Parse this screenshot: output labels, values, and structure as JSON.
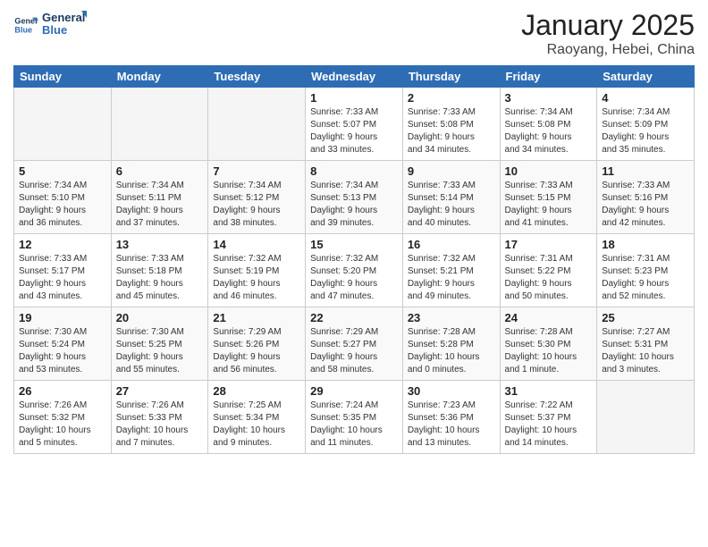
{
  "header": {
    "logo_line1": "General",
    "logo_line2": "Blue",
    "title": "January 2025",
    "subtitle": "Raoyang, Hebei, China"
  },
  "weekdays": [
    "Sunday",
    "Monday",
    "Tuesday",
    "Wednesday",
    "Thursday",
    "Friday",
    "Saturday"
  ],
  "weeks": [
    [
      {
        "day": "",
        "info": ""
      },
      {
        "day": "",
        "info": ""
      },
      {
        "day": "",
        "info": ""
      },
      {
        "day": "1",
        "info": "Sunrise: 7:33 AM\nSunset: 5:07 PM\nDaylight: 9 hours\nand 33 minutes."
      },
      {
        "day": "2",
        "info": "Sunrise: 7:33 AM\nSunset: 5:08 PM\nDaylight: 9 hours\nand 34 minutes."
      },
      {
        "day": "3",
        "info": "Sunrise: 7:34 AM\nSunset: 5:08 PM\nDaylight: 9 hours\nand 34 minutes."
      },
      {
        "day": "4",
        "info": "Sunrise: 7:34 AM\nSunset: 5:09 PM\nDaylight: 9 hours\nand 35 minutes."
      }
    ],
    [
      {
        "day": "5",
        "info": "Sunrise: 7:34 AM\nSunset: 5:10 PM\nDaylight: 9 hours\nand 36 minutes."
      },
      {
        "day": "6",
        "info": "Sunrise: 7:34 AM\nSunset: 5:11 PM\nDaylight: 9 hours\nand 37 minutes."
      },
      {
        "day": "7",
        "info": "Sunrise: 7:34 AM\nSunset: 5:12 PM\nDaylight: 9 hours\nand 38 minutes."
      },
      {
        "day": "8",
        "info": "Sunrise: 7:34 AM\nSunset: 5:13 PM\nDaylight: 9 hours\nand 39 minutes."
      },
      {
        "day": "9",
        "info": "Sunrise: 7:33 AM\nSunset: 5:14 PM\nDaylight: 9 hours\nand 40 minutes."
      },
      {
        "day": "10",
        "info": "Sunrise: 7:33 AM\nSunset: 5:15 PM\nDaylight: 9 hours\nand 41 minutes."
      },
      {
        "day": "11",
        "info": "Sunrise: 7:33 AM\nSunset: 5:16 PM\nDaylight: 9 hours\nand 42 minutes."
      }
    ],
    [
      {
        "day": "12",
        "info": "Sunrise: 7:33 AM\nSunset: 5:17 PM\nDaylight: 9 hours\nand 43 minutes."
      },
      {
        "day": "13",
        "info": "Sunrise: 7:33 AM\nSunset: 5:18 PM\nDaylight: 9 hours\nand 45 minutes."
      },
      {
        "day": "14",
        "info": "Sunrise: 7:32 AM\nSunset: 5:19 PM\nDaylight: 9 hours\nand 46 minutes."
      },
      {
        "day": "15",
        "info": "Sunrise: 7:32 AM\nSunset: 5:20 PM\nDaylight: 9 hours\nand 47 minutes."
      },
      {
        "day": "16",
        "info": "Sunrise: 7:32 AM\nSunset: 5:21 PM\nDaylight: 9 hours\nand 49 minutes."
      },
      {
        "day": "17",
        "info": "Sunrise: 7:31 AM\nSunset: 5:22 PM\nDaylight: 9 hours\nand 50 minutes."
      },
      {
        "day": "18",
        "info": "Sunrise: 7:31 AM\nSunset: 5:23 PM\nDaylight: 9 hours\nand 52 minutes."
      }
    ],
    [
      {
        "day": "19",
        "info": "Sunrise: 7:30 AM\nSunset: 5:24 PM\nDaylight: 9 hours\nand 53 minutes."
      },
      {
        "day": "20",
        "info": "Sunrise: 7:30 AM\nSunset: 5:25 PM\nDaylight: 9 hours\nand 55 minutes."
      },
      {
        "day": "21",
        "info": "Sunrise: 7:29 AM\nSunset: 5:26 PM\nDaylight: 9 hours\nand 56 minutes."
      },
      {
        "day": "22",
        "info": "Sunrise: 7:29 AM\nSunset: 5:27 PM\nDaylight: 9 hours\nand 58 minutes."
      },
      {
        "day": "23",
        "info": "Sunrise: 7:28 AM\nSunset: 5:28 PM\nDaylight: 10 hours\nand 0 minutes."
      },
      {
        "day": "24",
        "info": "Sunrise: 7:28 AM\nSunset: 5:30 PM\nDaylight: 10 hours\nand 1 minute."
      },
      {
        "day": "25",
        "info": "Sunrise: 7:27 AM\nSunset: 5:31 PM\nDaylight: 10 hours\nand 3 minutes."
      }
    ],
    [
      {
        "day": "26",
        "info": "Sunrise: 7:26 AM\nSunset: 5:32 PM\nDaylight: 10 hours\nand 5 minutes."
      },
      {
        "day": "27",
        "info": "Sunrise: 7:26 AM\nSunset: 5:33 PM\nDaylight: 10 hours\nand 7 minutes."
      },
      {
        "day": "28",
        "info": "Sunrise: 7:25 AM\nSunset: 5:34 PM\nDaylight: 10 hours\nand 9 minutes."
      },
      {
        "day": "29",
        "info": "Sunrise: 7:24 AM\nSunset: 5:35 PM\nDaylight: 10 hours\nand 11 minutes."
      },
      {
        "day": "30",
        "info": "Sunrise: 7:23 AM\nSunset: 5:36 PM\nDaylight: 10 hours\nand 13 minutes."
      },
      {
        "day": "31",
        "info": "Sunrise: 7:22 AM\nSunset: 5:37 PM\nDaylight: 10 hours\nand 14 minutes."
      },
      {
        "day": "",
        "info": ""
      }
    ]
  ]
}
